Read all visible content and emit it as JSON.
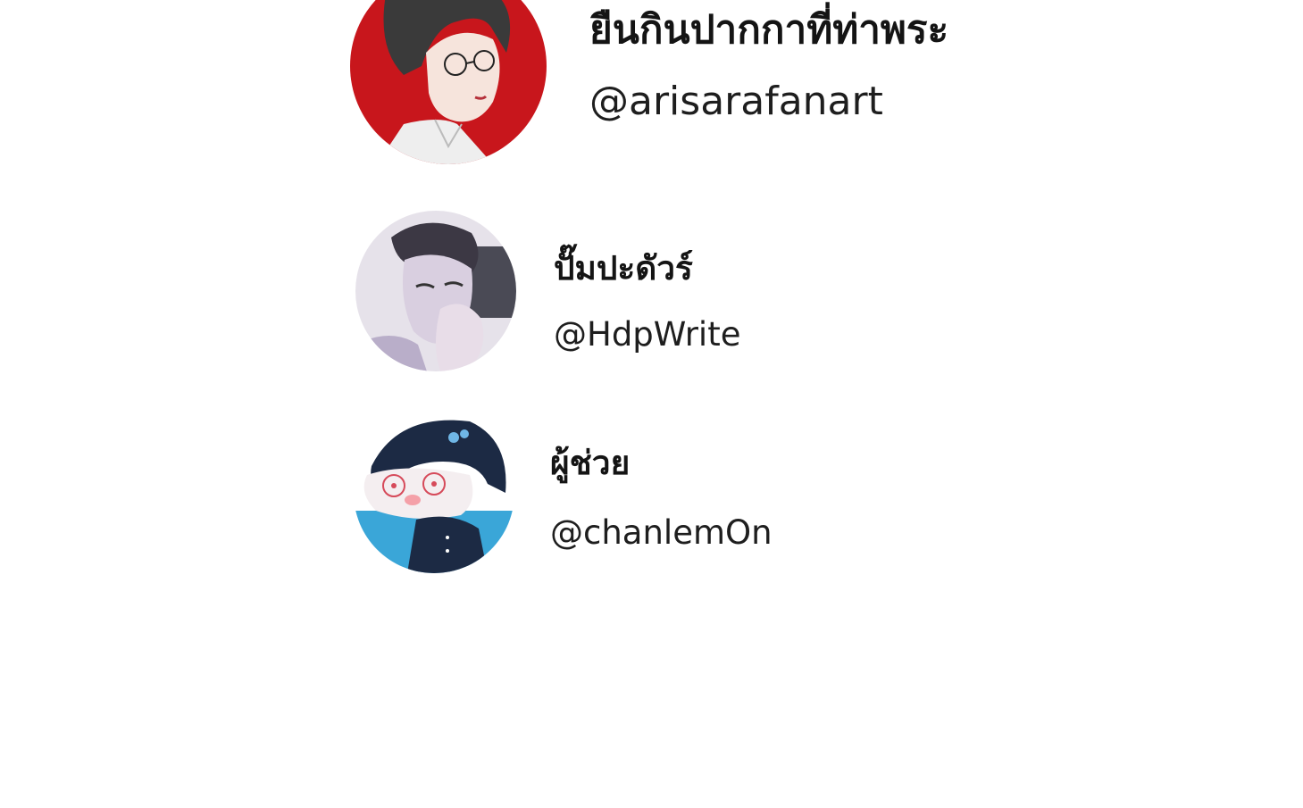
{
  "profiles": [
    {
      "name": "ยืนกินปากกาที่ท่าพระ",
      "handle": "@arisarafanart",
      "avatar_icon": "avatar-illustration-man-glasses",
      "avatar_bg": "#c8161c"
    },
    {
      "name": "ปั๊มปะดัวร์",
      "handle": "@HdpWrite",
      "avatar_icon": "avatar-illustration-man-hand-on-face",
      "avatar_bg": "#cfc8d8"
    },
    {
      "name": "ผู้ช่วย",
      "handle": "@chanlemOn",
      "avatar_icon": "avatar-illustration-cartoon-girl",
      "avatar_bg": "#3aa6d8"
    }
  ]
}
